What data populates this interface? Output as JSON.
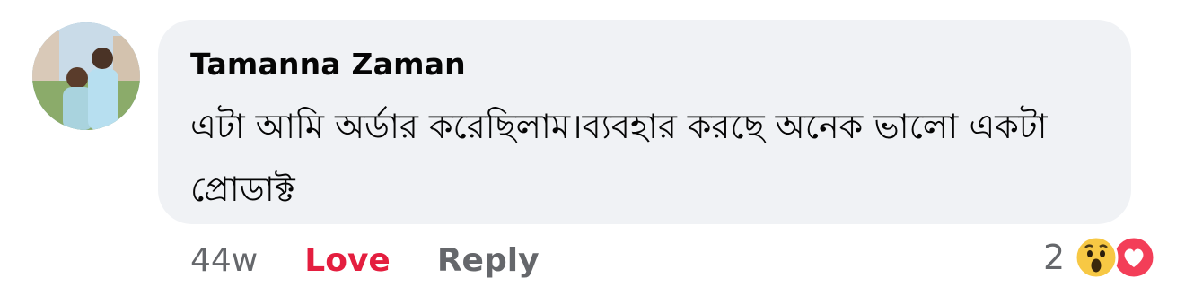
{
  "comment": {
    "author": "Tamanna Zaman",
    "body": "এটা আমি অর্ডার করেছিলাম।ব্যবহার করছে অনেক ভালো একটা প্রোডাক্ট",
    "timestamp": "44w",
    "reaction_label": "Love",
    "reply_label": "Reply",
    "reactions": {
      "count": "2",
      "types": [
        "wow-icon",
        "love-icon"
      ]
    }
  },
  "colors": {
    "bubble": "#f0f2f5",
    "text": "#050505",
    "muted": "#65676b",
    "love": "#e41e3f"
  }
}
